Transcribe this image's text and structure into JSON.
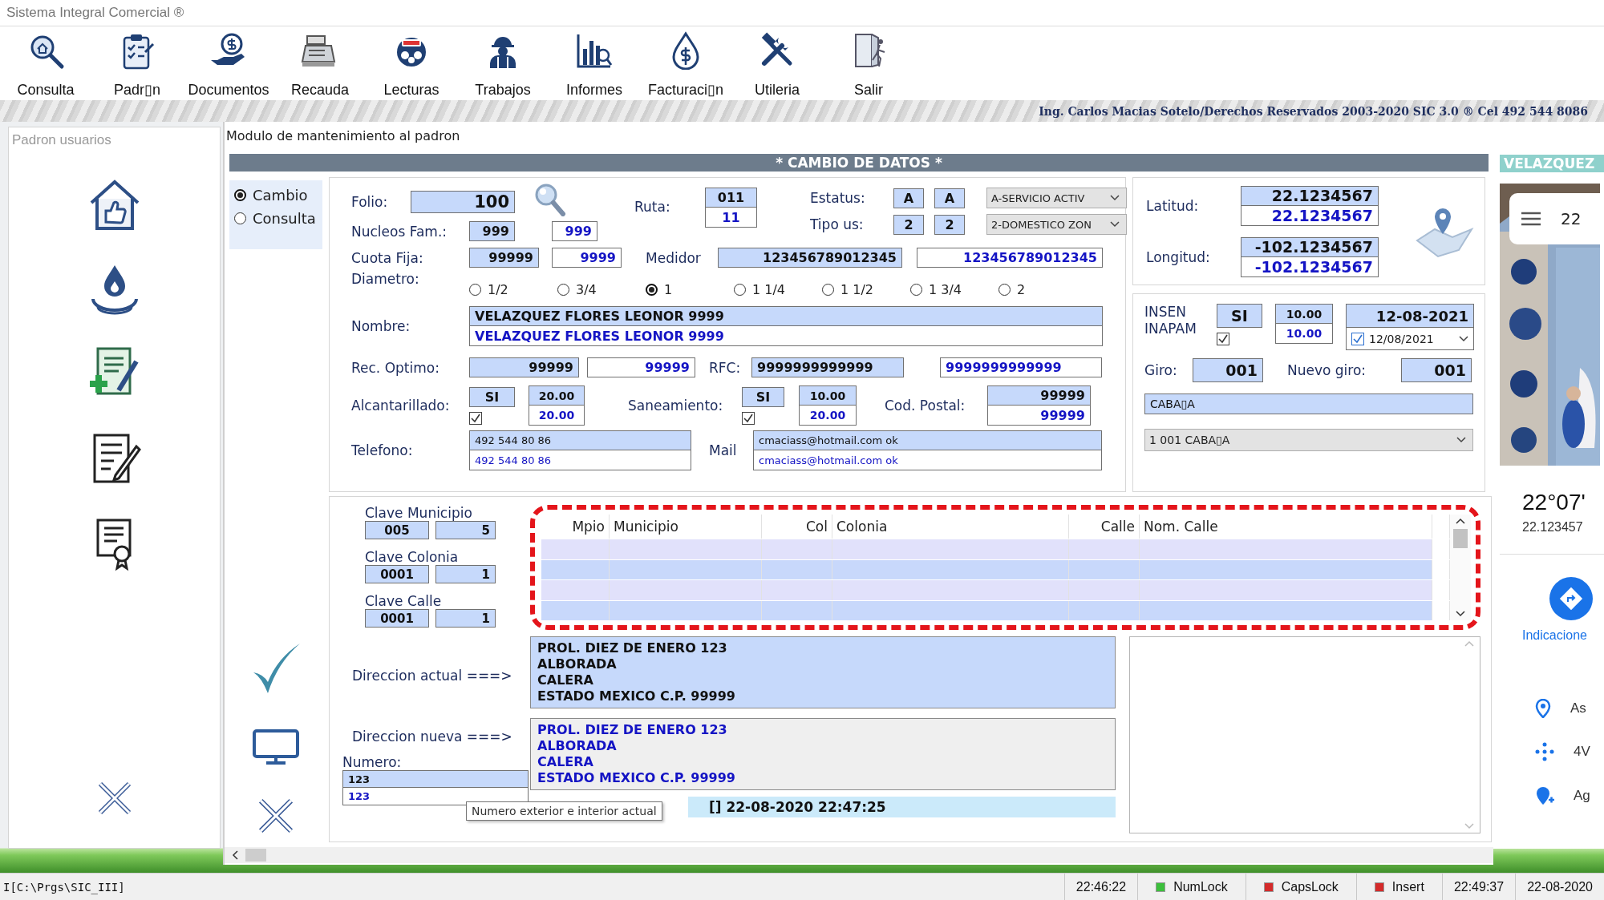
{
  "window": {
    "title": "Sistema Integral Comercial ®"
  },
  "toolbar": [
    {
      "label": "Consulta"
    },
    {
      "label": "Padr▯n"
    },
    {
      "label": "Documentos"
    },
    {
      "label": "Recauda"
    },
    {
      "label": "Lecturas"
    },
    {
      "label": "Trabajos"
    },
    {
      "label": "Informes"
    },
    {
      "label": "Facturaci▯n"
    },
    {
      "label": "Utileria"
    },
    {
      "label": "Salir"
    }
  ],
  "credits": "Ing. Carlos Macias Sotelo/Derechos Reservados 2003-2020 SIC 3.0 ® Cel 492 544 8086",
  "sidebar": {
    "title": "Padron usuarios"
  },
  "module_title": "Modulo de mantenimiento al padron",
  "section_title": "* CAMBIO DE DATOS *",
  "mode_options": [
    {
      "label": "Cambio",
      "selected": true
    },
    {
      "label": "Consulta",
      "selected": false
    }
  ],
  "folio": {
    "label": "Folio:",
    "value": "100"
  },
  "ruta": {
    "label": "Ruta:",
    "current": "011",
    "new": "11"
  },
  "estatus": {
    "label": "Estatus:",
    "current": "A",
    "new": "A",
    "option": "A-SERVICIO ACTIV"
  },
  "tipo_us": {
    "label": "Tipo us:",
    "current": "2",
    "new": "2",
    "option": "2-DOMESTICO ZON"
  },
  "nucleos": {
    "label": "Nucleos Fam.:",
    "current": "999",
    "new": "999"
  },
  "cuota": {
    "label": "Cuota Fija:",
    "current": "99999",
    "new": "9999"
  },
  "medidor": {
    "label": "Medidor",
    "current": "123456789012345",
    "new": "123456789012345"
  },
  "diametro": {
    "label": "Diametro:",
    "options": [
      {
        "label": "1/2",
        "selected": false
      },
      {
        "label": "3/4",
        "selected": false
      },
      {
        "label": "1",
        "selected": true
      },
      {
        "label": "1 1/4",
        "selected": false
      },
      {
        "label": "1 1/2",
        "selected": false
      },
      {
        "label": "1 3/4",
        "selected": false
      },
      {
        "label": "2",
        "selected": false
      }
    ]
  },
  "nombre": {
    "label": "Nombre:",
    "current": "VELAZQUEZ FLORES LEONOR 9999",
    "new": "VELAZQUEZ FLORES LEONOR 9999"
  },
  "rec_optimo": {
    "label": "Rec. Optimo:",
    "current": "99999",
    "new": "99999"
  },
  "rfc": {
    "label": "RFC:",
    "current": "9999999999999",
    "new": "9999999999999"
  },
  "alcantarillado": {
    "label": "Alcantarillado:",
    "value": "SI",
    "checked": true,
    "current": "20.00",
    "new": "20.00"
  },
  "saneamiento": {
    "label": "Saneamiento:",
    "value": "SI",
    "checked": true,
    "current": "10.00",
    "new": "20.00"
  },
  "cod_postal": {
    "label": "Cod. Postal:",
    "current": "99999",
    "new": "99999"
  },
  "telefono": {
    "label": "Telefono:",
    "current": "492 544 80 86",
    "new": "492 544 80 86"
  },
  "mail": {
    "label": "Mail",
    "current": "cmaciass@hotmail.com ok",
    "new": "cmaciass@hotmail.com ok"
  },
  "latitud": {
    "label": "Latitud:",
    "current": "22.1234567",
    "new": "22.1234567"
  },
  "longitud": {
    "label": "Longitud:",
    "current": "-102.1234567",
    "new": "-102.1234567"
  },
  "insen": {
    "label": "INSEN INAPAM",
    "value": "SI",
    "checked": true,
    "current": "10.00",
    "new": "10.00",
    "date": "12-08-2021",
    "picker": {
      "value": "12/08/2021",
      "checked": true
    }
  },
  "giro": {
    "label": "Giro:",
    "value": "001"
  },
  "nuevo_giro": {
    "label": "Nuevo giro:",
    "value": "001"
  },
  "giro_name": "CABA▯A",
  "giro_select": "1 001 CABA▯A",
  "claves": [
    {
      "label": "Clave Municipio",
      "current": "005",
      "new": "5"
    },
    {
      "label": "Clave Colonia",
      "current": "0001",
      "new": "1"
    },
    {
      "label": "Clave Calle",
      "current": "0001",
      "new": "1"
    }
  ],
  "table": {
    "columns": [
      "Mpio",
      "Municipio",
      "Col",
      "Colonia",
      "Calle",
      "Nom. Calle"
    ]
  },
  "direccion_actual": {
    "label": "Direccion actual ===>",
    "lines": [
      "PROL. DIEZ DE ENERO 123",
      "ALBORADA",
      "CALERA",
      "ESTADO MEXICO C.P. 99999"
    ]
  },
  "direccion_nueva": {
    "label": "Direccion nueva ===>",
    "lines": [
      "PROL. DIEZ DE ENERO 123",
      "ALBORADA",
      "CALERA",
      "ESTADO MEXICO C.P. 99999"
    ]
  },
  "numero": {
    "label": "Numero:",
    "current": "123",
    "new": "123"
  },
  "tooltip": "Numero exterior e interior actual",
  "timestamp": "[] 22-08-2020 22:47:25",
  "map_panel": {
    "title": "VELAZQUEZ",
    "search_text": "22",
    "coordinates": "22°07'",
    "decimal": "22.123457",
    "directions": "Indicacione",
    "places": [
      "As",
      "4V",
      "Ag"
    ]
  },
  "status_bar": {
    "path": "I[C:\\Prgs\\SIC_III]",
    "time_start": "22:46:22",
    "indicators": [
      {
        "label": "NumLock",
        "on": true
      },
      {
        "label": "CapsLock",
        "on": false
      },
      {
        "label": "Insert",
        "on": false
      }
    ],
    "time_now": "22:49:37",
    "date": "22-08-2020"
  }
}
